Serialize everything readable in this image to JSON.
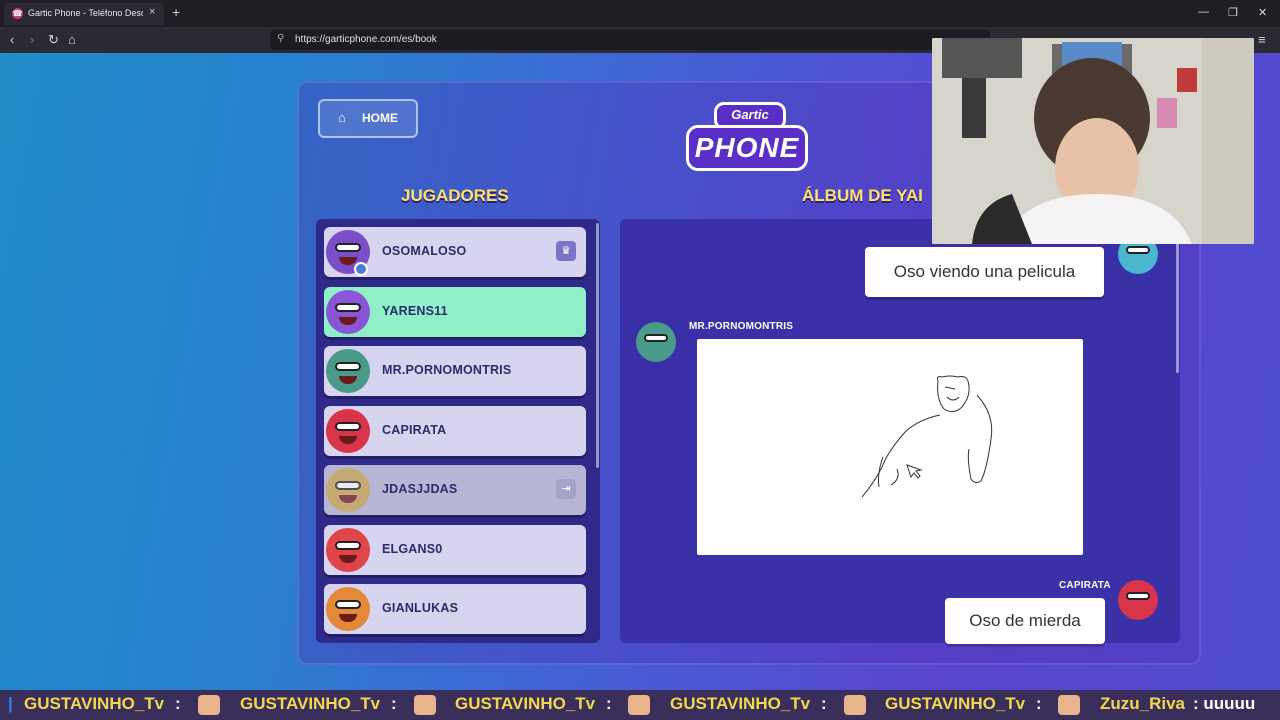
{
  "browser": {
    "tab_title": "Gartic Phone - Teléfono Descom",
    "tab_favicon": "☎",
    "url": "https://garticphone.com/es/book",
    "new_tab": "+",
    "close_tab": "×",
    "window_controls": [
      "—",
      "❐",
      "✕"
    ],
    "nav_icons": [
      "back-icon",
      "forward-icon",
      "reload-icon",
      "home-icon"
    ]
  },
  "game": {
    "home_label": "HOME",
    "logo_top": "Gartic",
    "logo_bottom": "PHONE",
    "players_title": "JUGADORES",
    "album_title": "ÁLBUM DE YAI",
    "players": [
      {
        "name": "OSOMALOSO",
        "state": "owner",
        "avatar_color": "#7a4ec8"
      },
      {
        "name": "YARENS11",
        "state": "active",
        "avatar_color": "#8a55d6"
      },
      {
        "name": "MR.PORNOMONTRIS",
        "state": "normal",
        "avatar_color": "#4a9a8a"
      },
      {
        "name": "CAPIRATA",
        "state": "normal",
        "avatar_color": "#d8344a"
      },
      {
        "name": "JDASJJDAS",
        "state": "away",
        "avatar_color": "#caa64a"
      },
      {
        "name": "ELGANS0",
        "state": "normal",
        "avatar_color": "#e0454a"
      },
      {
        "name": "GIANLUKAS",
        "state": "normal",
        "avatar_color": "#e28a3a"
      }
    ],
    "album": {
      "entry1_text": "Oso viendo una pelicula",
      "entry2_author": "MR.PORNOMONTRIS",
      "entry3_author": "CAPIRATA",
      "entry3_text": "Oso de mierda"
    }
  },
  "ticker": {
    "items": [
      {
        "user": "GUSTAVINHO_Tv",
        "msg": ":"
      },
      {
        "user": "GUSTAVINHO_Tv",
        "msg": ":"
      },
      {
        "user": "GUSTAVINHO_Tv",
        "msg": ":"
      },
      {
        "user": "GUSTAVINHO_Tv",
        "msg": ":"
      },
      {
        "user": "GUSTAVINHO_Tv",
        "msg": ":"
      },
      {
        "user": "Zuzu_Riva",
        "msg": ": uuuuu"
      }
    ]
  }
}
